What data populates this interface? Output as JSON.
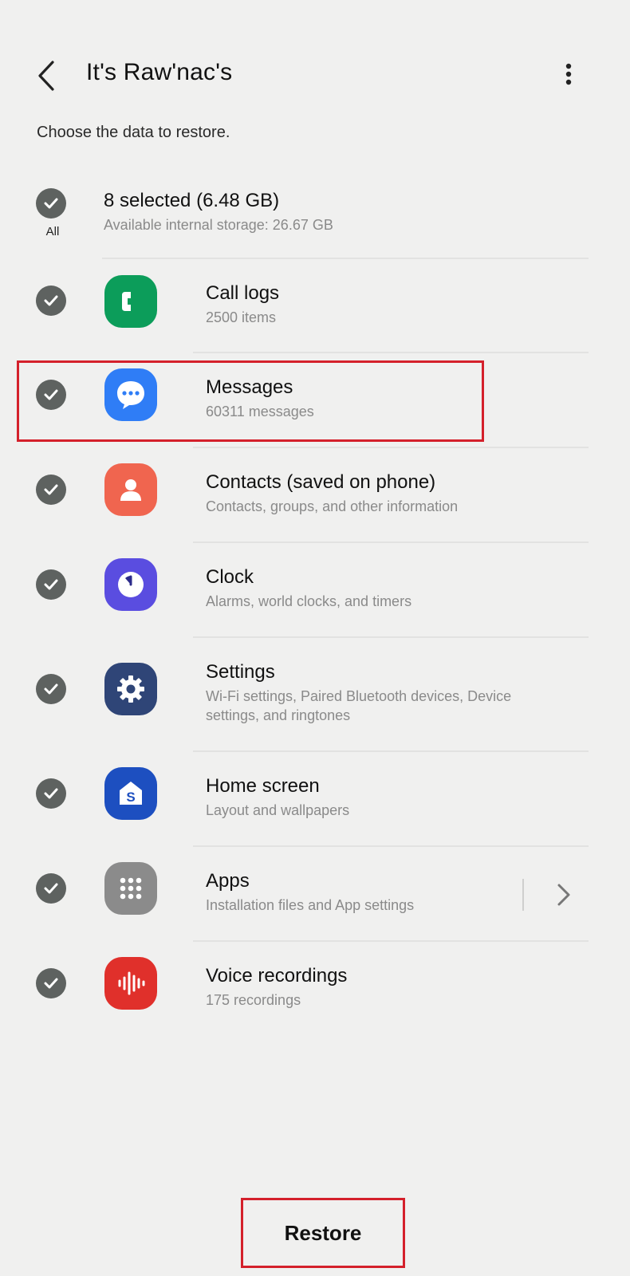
{
  "header": {
    "title": "It's Raw'nac's",
    "subtitle": "Choose the data to restore."
  },
  "summary": {
    "all_label": "All",
    "selected": "8 selected (6.48 GB)",
    "storage": "Available internal storage: 26.67 GB"
  },
  "items": [
    {
      "title": "Call logs",
      "subtitle": "2500 items",
      "icon": "phone-icon",
      "color": "#0c9d5a"
    },
    {
      "title": "Messages",
      "subtitle": "60311 messages",
      "icon": "chat-bubble-icon",
      "color": "#2f7df6"
    },
    {
      "title": "Contacts (saved on phone)",
      "subtitle": "Contacts, groups, and other information",
      "icon": "person-icon",
      "color": "#f0654f"
    },
    {
      "title": "Clock",
      "subtitle": "Alarms, world clocks, and timers",
      "icon": "clock-icon",
      "color": "#5a4de0"
    },
    {
      "title": "Settings",
      "subtitle": "Wi-Fi settings, Paired Bluetooth devices, Device settings, and ringtones",
      "icon": "gear-icon",
      "color": "#2f4577"
    },
    {
      "title": "Home screen",
      "subtitle": "Layout and wallpapers",
      "icon": "home-s-icon",
      "color": "#1d4fc0"
    },
    {
      "title": "Apps",
      "subtitle": "Installation files and App settings",
      "icon": "grid-icon",
      "color": "#8b8b8b"
    },
    {
      "title": "Voice recordings",
      "subtitle": "175 recordings",
      "icon": "waveform-icon",
      "color": "#e0302b"
    }
  ],
  "footer": {
    "restore_label": "Restore"
  },
  "colors": {
    "highlight": "#d4202b",
    "check": "#5e6260",
    "background": "#f0f0ef"
  }
}
